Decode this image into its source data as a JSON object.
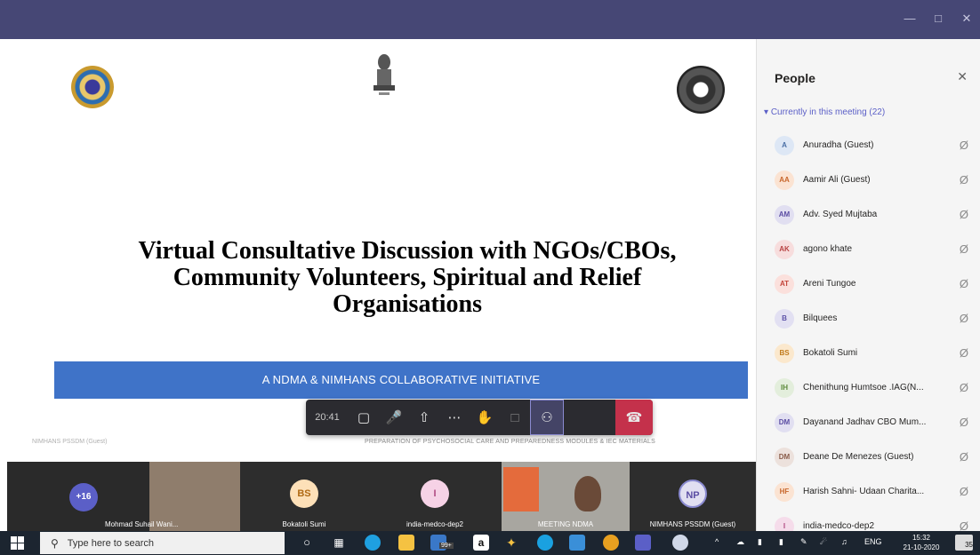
{
  "window": {
    "minimize_icon": "minimize-icon",
    "maximize_icon": "maximize-icon",
    "close_icon": "close-icon"
  },
  "slide": {
    "title_line1": "Virtual Consultative Discussion with NGOs/CBOs,",
    "title_line2": "Community Volunteers, Spiritual and Relief",
    "title_line3": "Organisations",
    "banner": "A NDMA & NIMHANS COLLABORATIVE INITIATIVE",
    "footer": "PREPARATION OF PSYCHOSOCIAL CARE AND PREPAREDNESS MODULES & IEC MATERIALS",
    "footer_left": "NIMHANS PSSDM (Guest)"
  },
  "controls": {
    "timer": "20:41",
    "icons": [
      "video-off-icon",
      "mic-off-icon",
      "share-icon",
      "more-icon",
      "raise-hand-icon",
      "chat-icon",
      "people-icon",
      "hangup-icon"
    ]
  },
  "strip": {
    "more_count": "+16",
    "tiles": [
      {
        "label": "Mohmad Suhail Wani...",
        "initials": ""
      },
      {
        "label": "Bokatoli Sumi",
        "initials": "BS"
      },
      {
        "label": "india-medco-dep2",
        "initials": "I"
      },
      {
        "label": "MEETING NDMA",
        "initials": ""
      },
      {
        "label": "NIMHANS PSSDM (Guest)",
        "initials": "NP"
      }
    ]
  },
  "people": {
    "title": "People",
    "section": "Currently in this meeting (22)",
    "list": [
      {
        "initials": "A",
        "name": "Anuradha (Guest)",
        "bg": "#dde7f5",
        "fg": "#4a6fa5"
      },
      {
        "initials": "AA",
        "name": "Aamir Ali (Guest)",
        "bg": "#fbe3d2",
        "fg": "#c8672c"
      },
      {
        "initials": "AM",
        "name": "Adv. Syed Mujtaba",
        "bg": "#e1dff1",
        "fg": "#5b4da3"
      },
      {
        "initials": "AK",
        "name": "agono khate",
        "bg": "#f7dddd",
        "fg": "#b84343"
      },
      {
        "initials": "AT",
        "name": "Areni Tungoe",
        "bg": "#fbe0dc",
        "fg": "#c4453a"
      },
      {
        "initials": "B",
        "name": "Bilquees",
        "bg": "#e2e0f2",
        "fg": "#5d52a8"
      },
      {
        "initials": "BS",
        "name": "Bokatoli Sumi",
        "bg": "#fbe8cd",
        "fg": "#c07a1c"
      },
      {
        "initials": "IH",
        "name": "Chenithung Humtsoe .IAG(N...",
        "bg": "#e3eedc",
        "fg": "#5c8a3a"
      },
      {
        "initials": "DM",
        "name": "Dayanand Jadhav CBO Mum...",
        "bg": "#e1dff1",
        "fg": "#5b4da3"
      },
      {
        "initials": "DM",
        "name": "Deane De Menezes (Guest)",
        "bg": "#ece1dc",
        "fg": "#8a5c4a"
      },
      {
        "initials": "HF",
        "name": "Harish Sahni- Udaan Charita...",
        "bg": "#fbe3d2",
        "fg": "#c8672c"
      },
      {
        "initials": "I",
        "name": "india-medco-dep2",
        "bg": "#f5dcea",
        "fg": "#b04a82"
      }
    ]
  },
  "taskbar": {
    "search_placeholder": "Type here to search",
    "badge": "99+",
    "language": "ENG",
    "time": "15:32",
    "date": "21-10-2020",
    "notif_count": "35"
  }
}
